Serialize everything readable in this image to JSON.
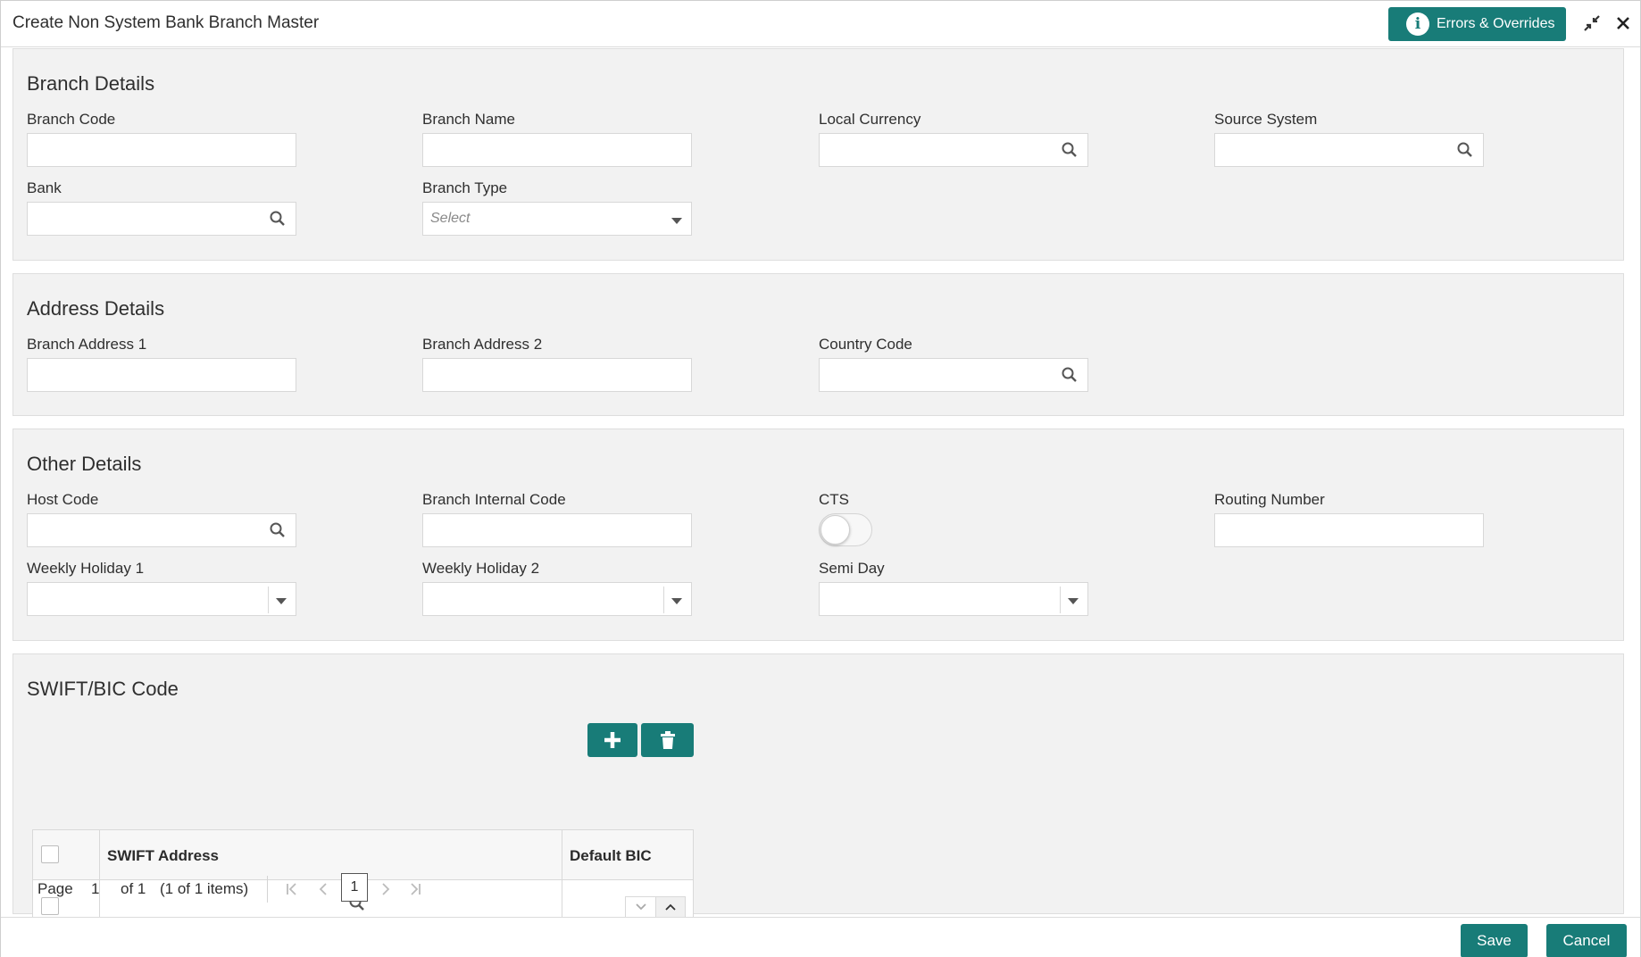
{
  "window": {
    "title": "Create Non System Bank Branch Master",
    "errors_button_label": "Errors & Overrides",
    "accent_color": "#187c78"
  },
  "branch_details": {
    "heading": "Branch Details",
    "branch_code_label": "Branch Code",
    "branch_name_label": "Branch Name",
    "local_currency_label": "Local Currency",
    "source_system_label": "Source System",
    "bank_label": "Bank",
    "branch_type_label": "Branch Type",
    "branch_type_placeholder": "Select"
  },
  "address_details": {
    "heading": "Address Details",
    "address1_label": "Branch Address 1",
    "address2_label": "Branch Address 2",
    "country_code_label": "Country Code"
  },
  "other_details": {
    "heading": "Other Details",
    "host_code_label": "Host Code",
    "internal_code_label": "Branch Internal Code",
    "cts_label": "CTS",
    "cts_enabled": false,
    "routing_number_label": "Routing Number",
    "weekly_holiday1_label": "Weekly Holiday 1",
    "weekly_holiday2_label": "Weekly Holiday 2",
    "semi_day_label": "Semi Day"
  },
  "swift": {
    "heading": "SWIFT/BIC Code",
    "columns": [
      "SWIFT Address",
      "Default BIC"
    ],
    "rows": [
      {
        "swift_address": "",
        "default_bic": ""
      }
    ],
    "pager": {
      "page_label": "Page",
      "current_page": "1",
      "of_label": "of 1",
      "items_label": "(1 of 1 items)",
      "page_box": "1"
    }
  },
  "footer": {
    "save_label": "Save",
    "cancel_label": "Cancel"
  },
  "icons": [
    "info-icon",
    "minimize-icon",
    "close-icon",
    "search-icon",
    "dropdown-caret-icon",
    "plus-icon",
    "trash-icon",
    "chevron-down-icon",
    "chevron-up-icon",
    "first-page-icon",
    "prev-page-icon",
    "next-page-icon",
    "last-page-icon"
  ]
}
